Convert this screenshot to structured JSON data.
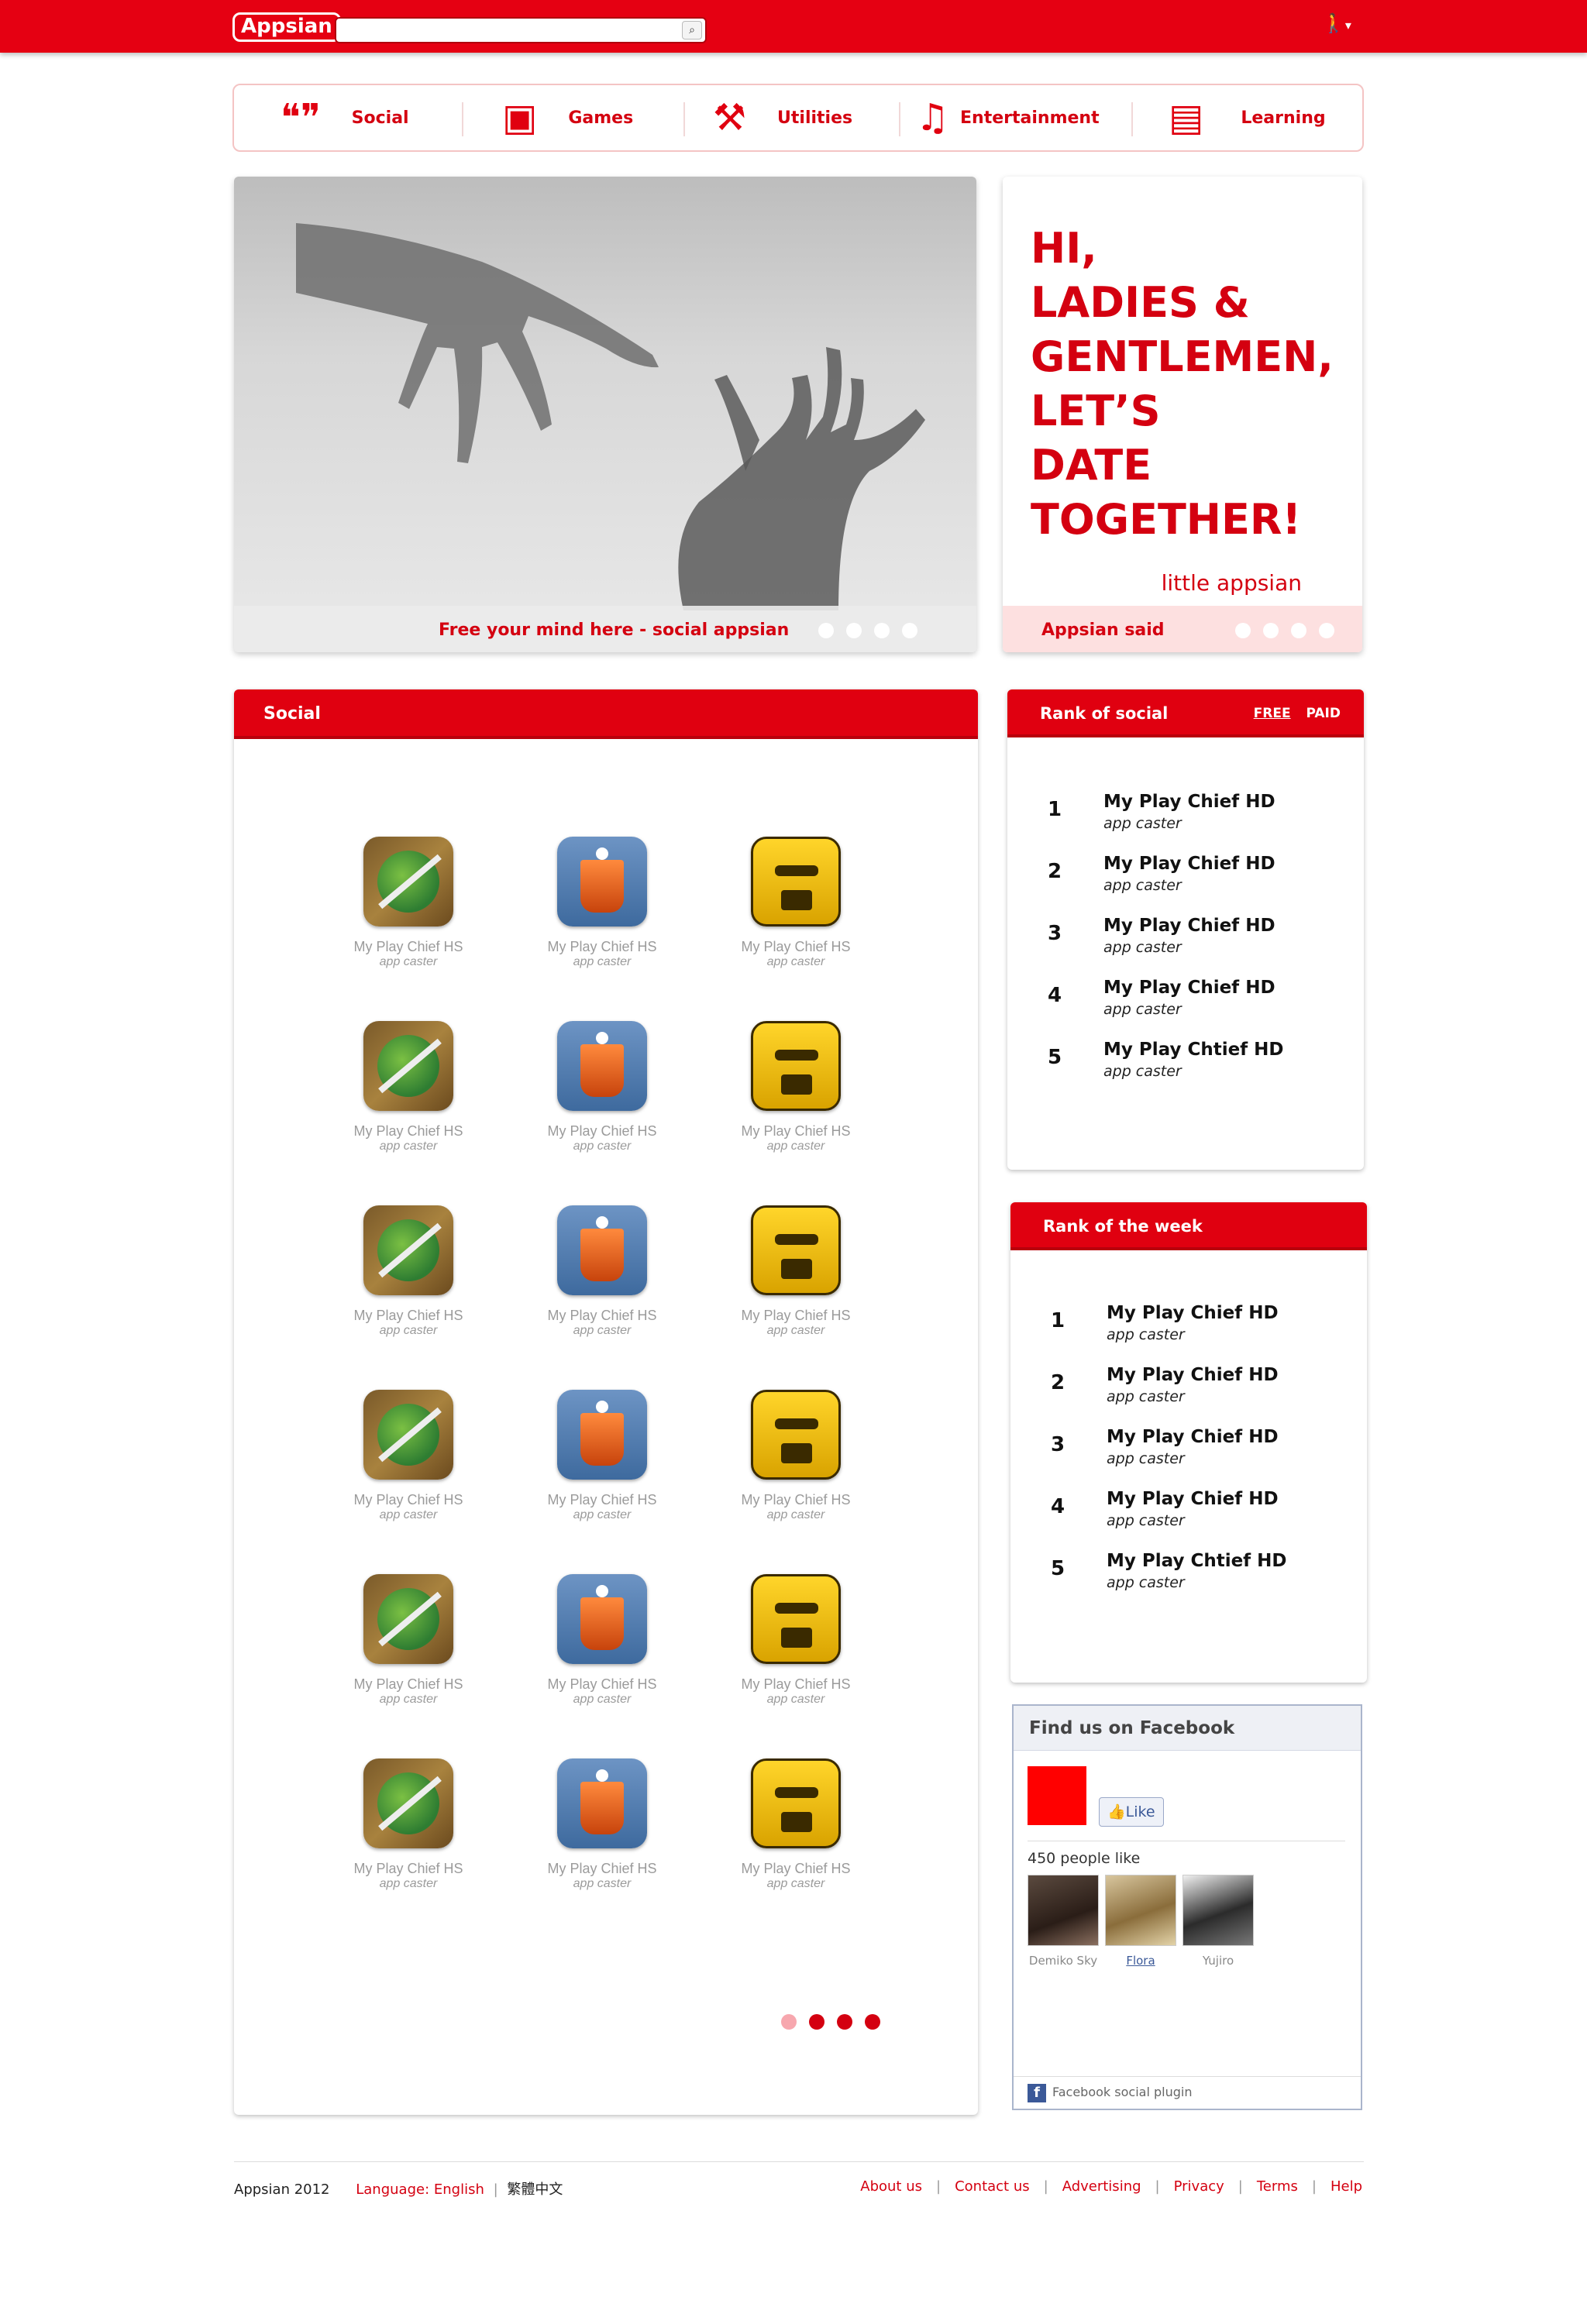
{
  "brand": {
    "logo_text": "Appsian",
    "accent": "#e00010"
  },
  "search": {
    "value": "",
    "placeholder": "",
    "icon": "search-icon"
  },
  "user_menu": {
    "icon": "person-icon",
    "caret": "▾"
  },
  "categories": [
    {
      "label": "Social",
      "icon": "quote-icon"
    },
    {
      "label": "Games",
      "icon": "gameboy-icon"
    },
    {
      "label": "Utilities",
      "icon": "tools-icon"
    },
    {
      "label": "Entertainment",
      "icon": "music-icon"
    },
    {
      "label": "Learning",
      "icon": "notes-icon"
    }
  ],
  "hero": {
    "caption": "Free your mind here - social appsian",
    "slides": 4
  },
  "promo": {
    "lines": [
      "HI,",
      "LADIES &",
      "GENTLEMEN,",
      "LET’S",
      "DATE",
      "TOGETHER!"
    ],
    "signature": "little appsian",
    "label": "Appsian said",
    "slides": 4
  },
  "social": {
    "title": "Social",
    "apps": [
      {
        "name": "My Play Chief HS",
        "dev": "app caster",
        "icon": "fruit-ninja-icon"
      },
      {
        "name": "My Play Chief HS",
        "dev": "app caster",
        "icon": "paper-toss-icon"
      },
      {
        "name": "My Play Chief HS",
        "dev": "app caster",
        "icon": "temple-run-icon"
      },
      {
        "name": "My Play Chief HS",
        "dev": "app caster",
        "icon": "fruit-ninja-icon"
      },
      {
        "name": "My Play Chief HS",
        "dev": "app caster",
        "icon": "paper-toss-icon"
      },
      {
        "name": "My Play Chief HS",
        "dev": "app caster",
        "icon": "temple-run-icon"
      },
      {
        "name": "My Play Chief HS",
        "dev": "app caster",
        "icon": "fruit-ninja-icon"
      },
      {
        "name": "My Play Chief HS",
        "dev": "app caster",
        "icon": "paper-toss-icon"
      },
      {
        "name": "My Play Chief HS",
        "dev": "app caster",
        "icon": "temple-run-icon"
      },
      {
        "name": "My Play Chief HS",
        "dev": "app caster",
        "icon": "fruit-ninja-icon"
      },
      {
        "name": "My Play Chief HS",
        "dev": "app caster",
        "icon": "paper-toss-icon"
      },
      {
        "name": "My Play Chief HS",
        "dev": "app caster",
        "icon": "temple-run-icon"
      },
      {
        "name": "My Play Chief HS",
        "dev": "app caster",
        "icon": "fruit-ninja-icon"
      },
      {
        "name": "My Play Chief HS",
        "dev": "app caster",
        "icon": "paper-toss-icon"
      },
      {
        "name": "My Play Chief HS",
        "dev": "app caster",
        "icon": "temple-run-icon"
      },
      {
        "name": "My Play Chief HS",
        "dev": "app caster",
        "icon": "fruit-ninja-icon"
      },
      {
        "name": "My Play Chief HS",
        "dev": "app caster",
        "icon": "paper-toss-icon"
      },
      {
        "name": "My Play Chief HS",
        "dev": "app caster",
        "icon": "temple-run-icon"
      }
    ],
    "pages": 4,
    "active_page": 1
  },
  "rank_social": {
    "title": "Rank of social",
    "tabs": [
      "FREE",
      "PAID"
    ],
    "selected_tab": "FREE",
    "items": [
      {
        "rank": "1",
        "name": "My Play Chief HD",
        "dev": "app caster"
      },
      {
        "rank": "2",
        "name": "My Play Chief HD",
        "dev": "app caster"
      },
      {
        "rank": "3",
        "name": "My Play Chief HD",
        "dev": "app caster"
      },
      {
        "rank": "4",
        "name": "My Play Chief HD",
        "dev": "app caster"
      },
      {
        "rank": "5",
        "name": "My Play Chtief HD",
        "dev": "app caster"
      }
    ]
  },
  "rank_week": {
    "title": "Rank of the week",
    "items": [
      {
        "rank": "1",
        "name": "My Play Chief HD",
        "dev": "app caster"
      },
      {
        "rank": "2",
        "name": "My Play Chief HD",
        "dev": "app caster"
      },
      {
        "rank": "3",
        "name": "My Play Chief HD",
        "dev": "app caster"
      },
      {
        "rank": "4",
        "name": "My Play Chief HD",
        "dev": "app caster"
      },
      {
        "rank": "5",
        "name": "My Play Chtief HD",
        "dev": "app caster"
      }
    ]
  },
  "facebook": {
    "title": "Find us on Facebook",
    "like_label": "Like",
    "count_text": "450 people like",
    "people": [
      {
        "name": "Demiko Sky",
        "link": false
      },
      {
        "name": "Flora",
        "link": true
      },
      {
        "name": "Yujiro",
        "link": false
      }
    ],
    "footer": "Facebook social plugin"
  },
  "footer": {
    "copyright": "Appsian 2012",
    "language_label": "Language: English",
    "alt_language": "繁體中文",
    "links": [
      "About us",
      "Contact us",
      "Advertising",
      "Privacy",
      "Terms",
      "Help"
    ]
  }
}
